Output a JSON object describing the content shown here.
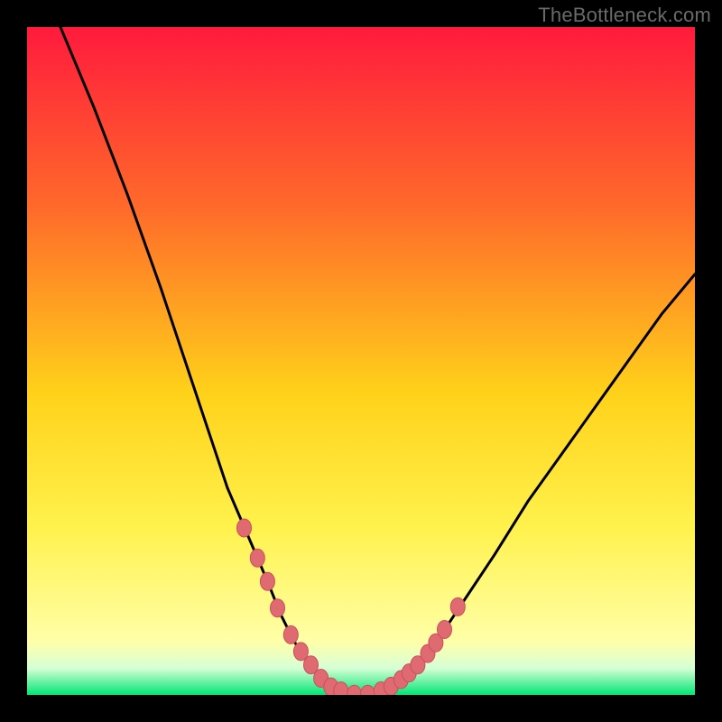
{
  "watermark": "TheBottleneck.com",
  "colors": {
    "frame": "#000000",
    "grad_top": "#ff1a3d",
    "grad_upper_mid": "#ff6a2a",
    "grad_mid": "#ffd21a",
    "grad_lower_mid": "#fff24d",
    "grad_pale": "#ffffa8",
    "grad_bottom": "#00e673",
    "curve": "#000000",
    "marker_fill": "#e06a72",
    "marker_stroke": "#c94f5a"
  },
  "chart_data": {
    "type": "line",
    "title": "",
    "xlabel": "",
    "ylabel": "",
    "xlim": [
      0,
      100
    ],
    "ylim": [
      0,
      100
    ],
    "series": [
      {
        "name": "bottleneck-curve",
        "x": [
          5,
          10,
          15,
          20,
          25,
          28,
          30,
          33,
          36,
          38,
          40,
          42,
          44,
          46,
          48,
          50,
          52,
          55,
          58,
          62,
          66,
          70,
          75,
          80,
          85,
          90,
          95,
          100
        ],
        "y": [
          100,
          88,
          75,
          61,
          46,
          37,
          31,
          24,
          17,
          12,
          8,
          5,
          2.5,
          1,
          0.3,
          0,
          0.3,
          1.5,
          4,
          9,
          15,
          21,
          29,
          36,
          43,
          50,
          57,
          63
        ]
      }
    ],
    "markers": {
      "name": "highlight-points",
      "x": [
        32.5,
        34.5,
        36.0,
        37.5,
        39.5,
        41.0,
        42.5,
        44.0,
        45.5,
        47.0,
        49.0,
        51.0,
        53.0,
        54.5,
        56.0,
        57.2,
        58.5,
        60.0,
        61.2,
        62.5,
        64.5
      ],
      "y": [
        25.0,
        20.5,
        17.0,
        13.0,
        9.0,
        6.5,
        4.5,
        2.5,
        1.2,
        0.6,
        0.1,
        0.1,
        0.6,
        1.3,
        2.3,
        3.3,
        4.5,
        6.2,
        7.8,
        9.8,
        13.2
      ]
    }
  }
}
